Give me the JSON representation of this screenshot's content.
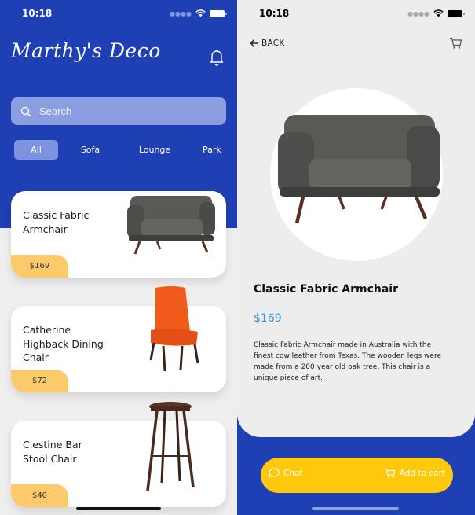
{
  "home": {
    "status_time": "10:18",
    "brand": "Marthy's Deco",
    "search": {
      "placeholder": "Search"
    },
    "categories": [
      {
        "label": "All",
        "active": true
      },
      {
        "label": "Sofa",
        "active": false
      },
      {
        "label": "Lounge",
        "active": false
      },
      {
        "label": "Park",
        "active": false
      }
    ],
    "products": [
      {
        "name": "Classic Fabric Armchair",
        "price": "$169",
        "icon": "armchair-image"
      },
      {
        "name": "Catherine Highback Dining Chair",
        "price": "$72",
        "icon": "dining-chair-image"
      },
      {
        "name": "Ciestine Bar Stool Chair",
        "price": "$40",
        "icon": "bar-stool-image"
      }
    ]
  },
  "detail": {
    "status_time": "10:18",
    "back_label": "BACK",
    "title": "Classic Fabric Armchair",
    "price": "$169",
    "description": "Classic Fabric Armchair made in Australia with the finest cow leather from Texas. The wooden legs were made from a 200 year old oak tree. This chair is a unique piece of art.",
    "chat_label": "Chat",
    "add_to_cart_label": "Add to cart"
  },
  "colors": {
    "brand_blue": "#1f3fb5",
    "price_tag": "#fcc96b",
    "action_yellow": "#fec90d",
    "price_text": "#3a8fe6"
  }
}
